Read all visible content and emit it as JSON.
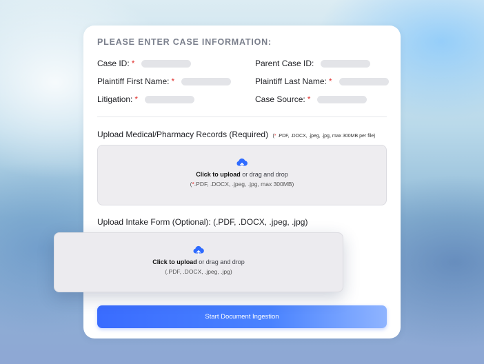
{
  "form": {
    "heading": "PLEASE ENTER CASE INFORMATION:",
    "required_mark": "*",
    "fields": {
      "case_id": "Case ID:",
      "parent_case_id": "Parent Case ID:",
      "plaintiff_first": "Plaintiff First Name:",
      "plaintiff_last": "Plaintiff Last Name:",
      "litigation": "Litigation:",
      "case_source": "Case Source:"
    }
  },
  "medical_upload": {
    "label": "Upload Medical/Pharmacy Records (Required)",
    "note_star": "*",
    "note_text": " .PDF, .DOCX, .jpeg, .jpg, max 300MB per file)",
    "note_open": "(",
    "click_text": "Click to upload",
    "drag_text": " or drag and drop",
    "formats_open": "(",
    "formats_star": "*",
    "formats_text": ".PDF, .DOCX, .jpeg, .jpg, max 300MB)"
  },
  "intake_upload": {
    "label": "Upload Intake Form (Optional): (.PDF, .DOCX, .jpeg, .jpg)",
    "click_text": "Click to upload",
    "drag_text": " or drag and drop",
    "formats_text": "(.PDF, .DOCX, .jpeg, .jpg)"
  },
  "actions": {
    "start_label": "Start Document Ingestion"
  },
  "icons": {
    "upload": "cloud-upload-icon"
  },
  "colors": {
    "accent": "#3a6cff",
    "required": "#e0322f"
  }
}
